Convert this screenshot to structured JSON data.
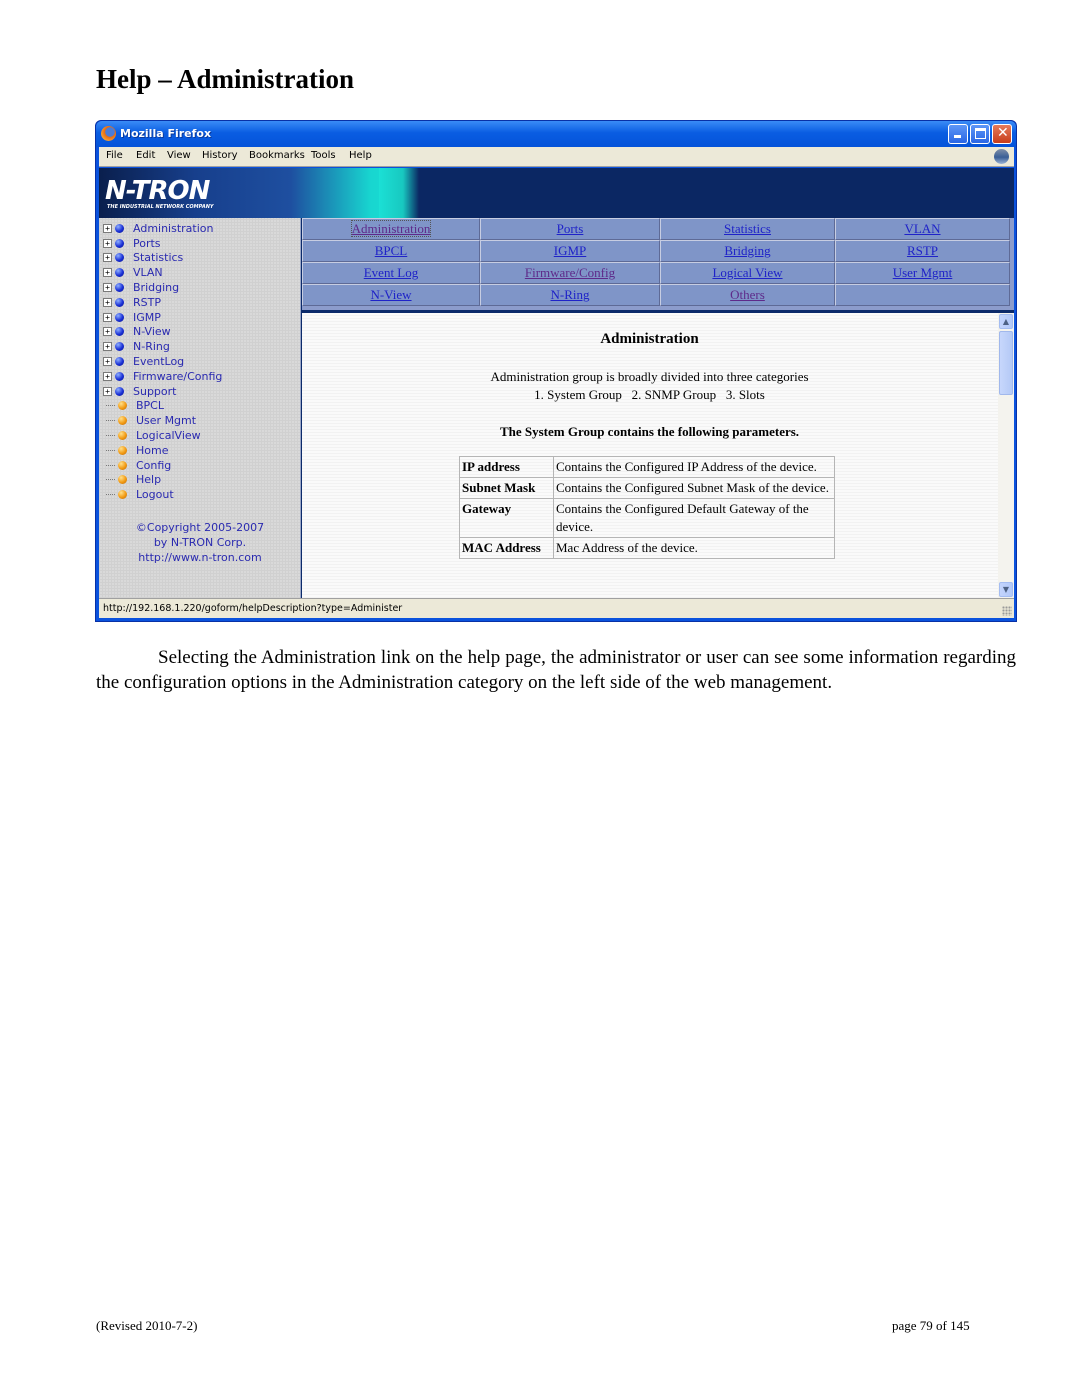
{
  "document": {
    "heading": "Help – Administration",
    "paragraph": "Selecting the Administration link on the help page, the administrator or user can see some information regarding the configuration options in the Administration category on the left side of the web management.",
    "footer_left": "(Revised 2010-7-2)",
    "footer_right": "page 79 of 145"
  },
  "browser": {
    "title": "Mozilla Firefox",
    "menu": [
      "File",
      "Edit",
      "View",
      "History",
      "Bookmarks",
      "Tools",
      "Help"
    ],
    "status_url": "http://192.168.1.220/goform/helpDescription?type=Administer"
  },
  "banner": {
    "logo": "N-TRON",
    "tagline": "THE INDUSTRIAL NETWORK COMPANY"
  },
  "sidebar": {
    "items": [
      {
        "label": "Administration",
        "expandable": true,
        "icon": "blue-ball-icon"
      },
      {
        "label": "Ports",
        "expandable": true,
        "icon": "blue-ball-icon"
      },
      {
        "label": "Statistics",
        "expandable": true,
        "icon": "blue-ball-icon"
      },
      {
        "label": "VLAN",
        "expandable": true,
        "icon": "blue-ball-icon"
      },
      {
        "label": "Bridging",
        "expandable": true,
        "icon": "blue-ball-icon"
      },
      {
        "label": "RSTP",
        "expandable": true,
        "icon": "blue-ball-icon"
      },
      {
        "label": "IGMP",
        "expandable": true,
        "icon": "blue-ball-icon"
      },
      {
        "label": "N-View",
        "expandable": true,
        "icon": "blue-ball-icon"
      },
      {
        "label": "N-Ring",
        "expandable": true,
        "icon": "blue-ball-icon"
      },
      {
        "label": "EventLog",
        "expandable": true,
        "icon": "blue-ball-icon"
      },
      {
        "label": "Firmware/Config",
        "expandable": true,
        "icon": "blue-ball-icon"
      },
      {
        "label": "Support",
        "expandable": true,
        "icon": "blue-ball-icon"
      },
      {
        "label": "BPCL",
        "expandable": false,
        "icon": "orange-ball-icon"
      },
      {
        "label": "User Mgmt",
        "expandable": false,
        "icon": "orange-ball-icon"
      },
      {
        "label": "LogicalView",
        "expandable": false,
        "icon": "orange-ball-icon"
      },
      {
        "label": "Home",
        "expandable": false,
        "icon": "orange-ball-icon"
      },
      {
        "label": "Config",
        "expandable": false,
        "icon": "orange-ball-icon"
      },
      {
        "label": "Help",
        "expandable": false,
        "icon": "orange-ball-icon"
      },
      {
        "label": "Logout",
        "expandable": false,
        "icon": "orange-ball-icon"
      }
    ],
    "copyright_lines": [
      "©Copyright 2005-2007",
      "by N-TRON Corp.",
      "http://www.n-tron.com"
    ]
  },
  "help_nav": {
    "links": [
      {
        "label": "Administration",
        "state": "focused"
      },
      {
        "label": "Ports",
        "state": "link"
      },
      {
        "label": "Statistics",
        "state": "link"
      },
      {
        "label": "VLAN",
        "state": "link"
      },
      {
        "label": "BPCL",
        "state": "link"
      },
      {
        "label": "IGMP",
        "state": "link"
      },
      {
        "label": "Bridging",
        "state": "link"
      },
      {
        "label": "RSTP",
        "state": "link"
      },
      {
        "label": "Event Log",
        "state": "link"
      },
      {
        "label": "Firmware/Config",
        "state": "visited"
      },
      {
        "label": "Logical View",
        "state": "link"
      },
      {
        "label": "User Mgmt",
        "state": "link"
      },
      {
        "label": "N-View",
        "state": "link"
      },
      {
        "label": "N-Ring",
        "state": "link"
      },
      {
        "label": "Others",
        "state": "visited"
      },
      {
        "label": "",
        "state": "empty"
      }
    ]
  },
  "help_page": {
    "heading": "Administration",
    "intro_line1": "Administration group is broadly divided into three categories",
    "intro_line2": "1. System Group   2. SNMP Group   3. Slots",
    "system_group_heading": "The System Group contains the following parameters.",
    "parameters": [
      {
        "name": "IP address",
        "description": "Contains the Configured IP Address of the device."
      },
      {
        "name": "Subnet Mask",
        "description": "Contains the Configured Subnet Mask of the device."
      },
      {
        "name": "Gateway",
        "description": "Contains the Configured Default Gateway of the device."
      },
      {
        "name": "MAC Address",
        "description": "Mac Address of the device."
      }
    ]
  }
}
